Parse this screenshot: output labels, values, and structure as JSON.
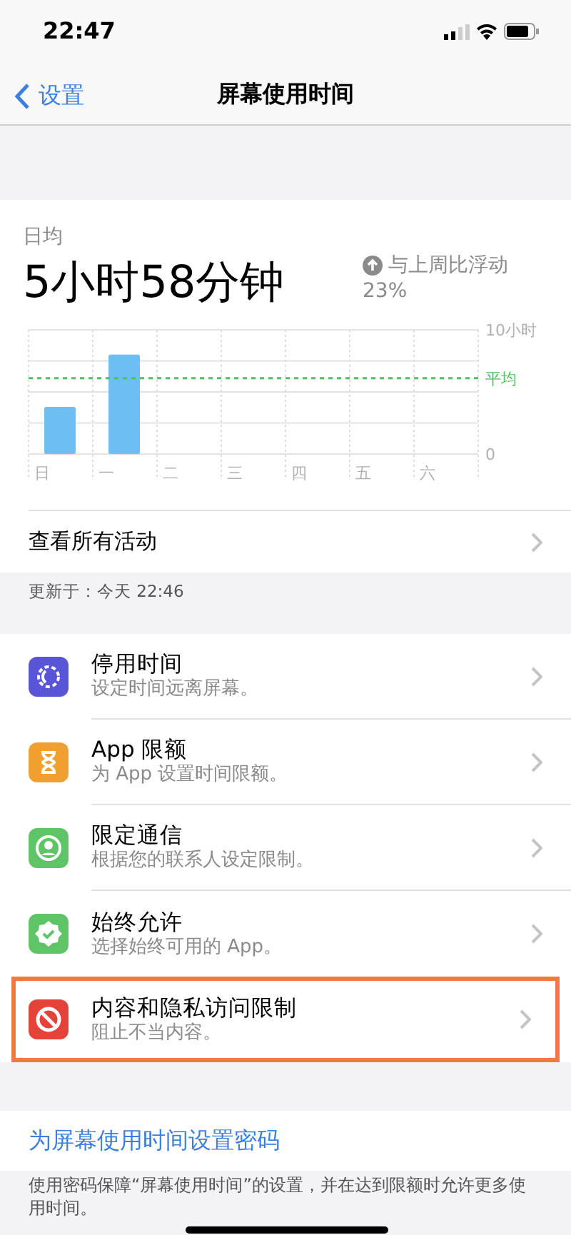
{
  "status_bar": {
    "time": "22:47"
  },
  "nav": {
    "back": "设置",
    "title": "屏幕使用时间"
  },
  "summary": {
    "label": "日均",
    "value": "5小时58分钟",
    "trend_text": "与上周比浮动",
    "trend_percent": "23%"
  },
  "chart_data": {
    "type": "bar",
    "categories": [
      "日",
      "一",
      "二",
      "三",
      "四",
      "五",
      "六"
    ],
    "series": [
      {
        "color": "#6cbff2",
        "values": [
          3.8,
          8.0,
          null,
          null,
          null,
          null,
          null
        ]
      }
    ],
    "ylim": [
      0,
      10
    ],
    "yticks": [
      {
        "value": 0,
        "label": "0"
      },
      {
        "value": 10,
        "label": "10小时"
      }
    ],
    "ref_lines": [
      {
        "axis": "y",
        "value": 6.1,
        "label": "平均",
        "color": "#4cc25a"
      }
    ]
  },
  "see_all": {
    "label": "查看所有活动"
  },
  "updated": "更新于：今天 22:46",
  "items": [
    {
      "kind": "downtime",
      "title": "停用时间",
      "subtitle": "设定时间远离屏幕。",
      "color": "#5856d6",
      "highlighted": false
    },
    {
      "kind": "limits",
      "title": "App 限额",
      "subtitle": "为 App 设置时间限额。",
      "color": "#f0a030",
      "highlighted": false
    },
    {
      "kind": "communication",
      "title": "限定通信",
      "subtitle": "根据您的联系人设定限制。",
      "color": "#5ec466",
      "highlighted": false
    },
    {
      "kind": "allowed",
      "title": "始终允许",
      "subtitle": "选择始终可用的 App。",
      "color": "#5ec466",
      "highlighted": false
    },
    {
      "kind": "restrictions",
      "title": "内容和隐私访问限制",
      "subtitle": "阻止不当内容。",
      "color": "#e5433a",
      "highlighted": true
    }
  ],
  "passcode": {
    "label": "为屏幕使用时间设置密码",
    "footer": "使用密码保障“屏幕使用时间”的设置，并在达到限额时允许更多使用时间。"
  }
}
